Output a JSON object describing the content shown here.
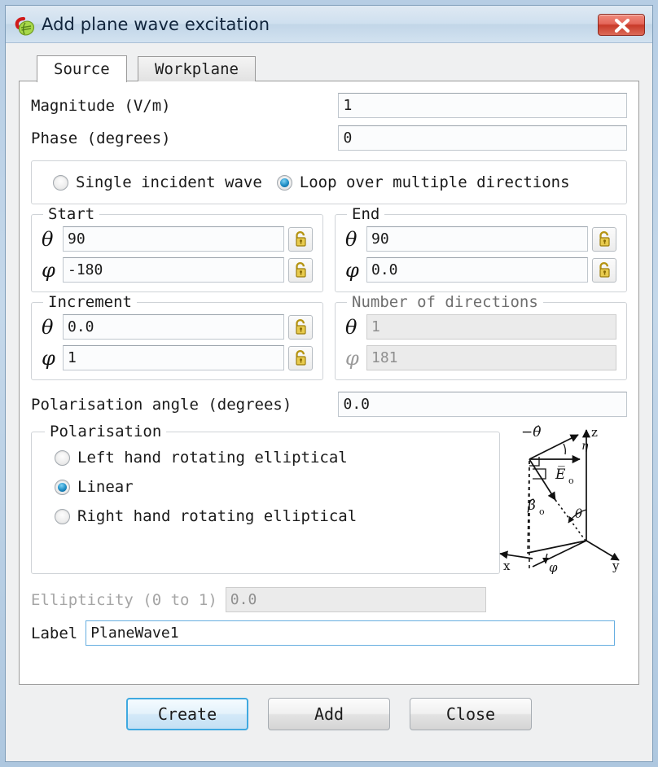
{
  "window": {
    "title": "Add plane wave excitation",
    "app_icon": "cadfeko-app-icon",
    "close_label": "✕",
    "close_icon": "close-icon",
    "accent_color": "#3fa9e0",
    "titlebar_color": "#cfe0ef",
    "close_button_color": "#c83a29"
  },
  "tabs": [
    {
      "label": "Source",
      "active": true
    },
    {
      "label": "Workplane",
      "active": false
    }
  ],
  "fields": {
    "magnitude": {
      "label": "Magnitude (V/m)",
      "value": "1",
      "placeholder": ""
    },
    "phase": {
      "label": "Phase (degrees)",
      "value": "0",
      "placeholder": ""
    },
    "polarisation_angle": {
      "label": "Polarisation angle (degrees)",
      "value": "0.0",
      "placeholder": ""
    },
    "ellipticity": {
      "label": "Ellipticity (0 to 1)",
      "value": "0.0",
      "placeholder": "",
      "disabled": true
    },
    "label": {
      "label": "Label",
      "value": "PlaneWave1",
      "placeholder": "",
      "focused": true
    }
  },
  "incident_mode": {
    "options": [
      {
        "label": "Single incident wave",
        "selected": false
      },
      {
        "label": "Loop over multiple directions",
        "selected": true
      }
    ]
  },
  "angle_groups": {
    "start": {
      "title": "Start",
      "theta": {
        "symbol": "θ",
        "value": "90",
        "lock_icon": "unlocked-padlock-icon",
        "locked": false
      },
      "phi": {
        "symbol": "φ",
        "value": "-180",
        "lock_icon": "unlocked-padlock-icon",
        "locked": false
      }
    },
    "end": {
      "title": "End",
      "theta": {
        "symbol": "θ",
        "value": "90",
        "lock_icon": "unlocked-padlock-icon",
        "locked": false
      },
      "phi": {
        "symbol": "φ",
        "value": "0.0",
        "lock_icon": "unlocked-padlock-icon",
        "locked": false
      }
    },
    "increment": {
      "title": "Increment",
      "theta": {
        "symbol": "θ",
        "value": "0.0",
        "lock_icon": "unlocked-padlock-icon",
        "locked": false
      },
      "phi": {
        "symbol": "φ",
        "value": "1",
        "lock_icon": "unlocked-padlock-icon",
        "locked": false
      }
    },
    "number_of_directions": {
      "title": "Number of directions",
      "disabled": true,
      "theta": {
        "symbol": "θ",
        "value": "1"
      },
      "phi": {
        "symbol": "φ",
        "value": "181"
      }
    }
  },
  "polarisation": {
    "title": "Polarisation",
    "options": [
      {
        "label": "Left hand rotating elliptical",
        "selected": false
      },
      {
        "label": "Linear",
        "selected": true
      },
      {
        "label": "Right hand rotating elliptical",
        "selected": false
      }
    ],
    "diagram": {
      "name": "polarisation-coordinate-diagram",
      "labels": {
        "z_axis": "z",
        "y_axis": "y",
        "x_axis": "x",
        "theta_hat_negative": "−θ̂",
        "eta": "η",
        "e_field": "E̅",
        "e_field_sub": "o",
        "beta_hat": "β̂",
        "beta_sub": "o",
        "theta": "θ",
        "phi": "φ"
      }
    }
  },
  "buttons": [
    {
      "label": "Create",
      "default": true
    },
    {
      "label": "Add",
      "default": false
    },
    {
      "label": "Close",
      "default": false
    }
  ]
}
